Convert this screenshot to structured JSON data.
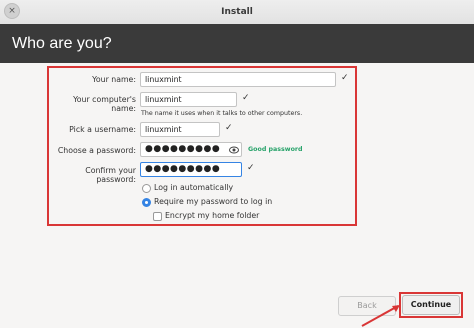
{
  "window": {
    "title": "Install",
    "close_icon": "×"
  },
  "header": {
    "title": "Who are you?"
  },
  "form": {
    "name_label": "Your name:",
    "name_value": "linuxmint",
    "computer_label": "Your computer's name:",
    "computer_value": "linuxmint",
    "computer_hint": "The name it uses when it talks to other computers.",
    "username_label": "Pick a username:",
    "username_value": "linuxmint",
    "password_label": "Choose a password:",
    "password_value": "●●●●●●●●●",
    "password_strength": "Good password",
    "confirm_label": "Confirm your password:",
    "confirm_value": "●●●●●●●●●",
    "check_mark": "✓",
    "option_auto_login": "Log in automatically",
    "option_require_password": "Require my password to log in",
    "option_encrypt_home": "Encrypt my home folder",
    "auto_login_selected": false,
    "require_password_selected": true,
    "encrypt_home_checked": false
  },
  "buttons": {
    "back": "Back",
    "continue": "Continue"
  },
  "colors": {
    "highlight": "#d93636",
    "accent": "#3584e4",
    "good": "#26a269",
    "header_bg": "#3a3a3a"
  }
}
